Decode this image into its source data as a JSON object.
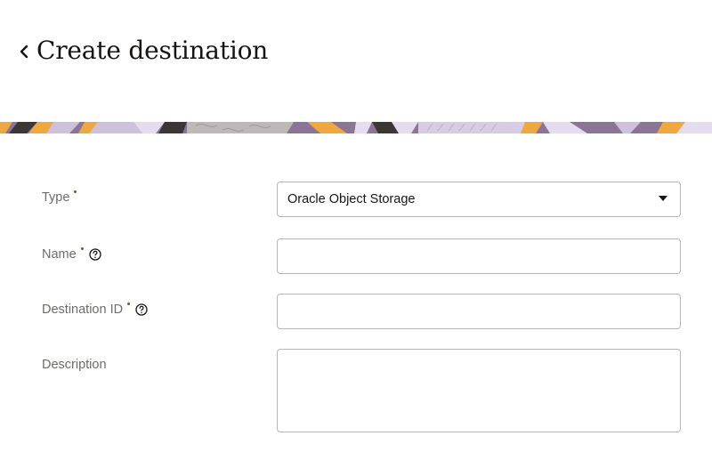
{
  "header": {
    "back_icon": "chevron-left-icon",
    "title": "Create destination"
  },
  "form": {
    "type": {
      "label": "Type",
      "required": true,
      "value": "Oracle Object Storage",
      "icon": "caret-down-icon"
    },
    "name": {
      "label": "Name",
      "required": true,
      "help_icon": "help-circle-icon",
      "value": "",
      "placeholder": ""
    },
    "destination_id": {
      "label": "Destination ID",
      "required": true,
      "help_icon": "help-circle-icon",
      "value": "",
      "placeholder": ""
    },
    "description": {
      "label": "Description",
      "value": "",
      "placeholder": ""
    }
  },
  "colors": {
    "title": "#161513",
    "label": "#6f6c68",
    "border": "#b9b6b2",
    "banner_purple": "#8b7597",
    "banner_orange": "#f0a740",
    "banner_lilac": "#cfc0dc",
    "banner_gray": "#bdbab6",
    "banner_dark": "#3a3734"
  }
}
